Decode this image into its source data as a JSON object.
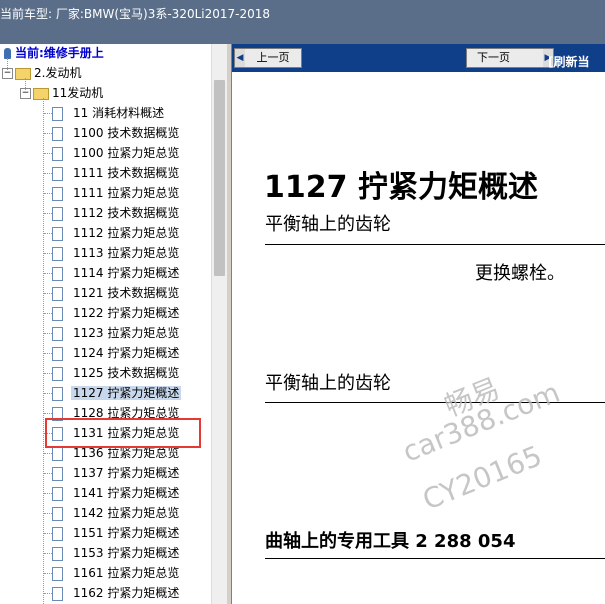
{
  "window": {
    "title": "当前车型:  厂家:BMW(宝马)3系-320Li2017-2018"
  },
  "tree": {
    "root_label": "当前:维修手册上",
    "level1_label": "2.发动机",
    "level2_label": "11发动机",
    "items": [
      {
        "label": "11 消耗材料概述"
      },
      {
        "label": "1100 技术数据概览"
      },
      {
        "label": "1100 拉紧力矩总览"
      },
      {
        "label": "1111 技术数据概览"
      },
      {
        "label": "1111 拉紧力矩总览"
      },
      {
        "label": "1112 技术数据概览"
      },
      {
        "label": "1112 拉紧力矩总览"
      },
      {
        "label": "1113 拉紧力矩总览"
      },
      {
        "label": "1114 拧紧力矩概述"
      },
      {
        "label": "1121 技术数据概览"
      },
      {
        "label": "1122 拧紧力矩概述"
      },
      {
        "label": "1123 拉紧力矩总览"
      },
      {
        "label": "1124 拧紧力矩概述"
      },
      {
        "label": "1125 技术数据概览"
      },
      {
        "label": "1127 拧紧力矩概述"
      },
      {
        "label": "1128 拉紧力矩总览"
      },
      {
        "label": "1131 拉紧力矩总览"
      },
      {
        "label": "1136 拉紧力矩总览"
      },
      {
        "label": "1137 拧紧力矩概述"
      },
      {
        "label": "1141 拧紧力矩概述"
      },
      {
        "label": "1142 拉紧力矩总览"
      },
      {
        "label": "1151 拧紧力矩概述"
      },
      {
        "label": "1153 拧紧力矩概述"
      },
      {
        "label": "1161 拉紧力矩总览"
      },
      {
        "label": "1162 拧紧力矩概述"
      }
    ],
    "selected_label": "1127 拧紧力矩概述"
  },
  "nav": {
    "prev_label": "上一页",
    "next_label": "下一页",
    "refresh_label": "[刷新当"
  },
  "document": {
    "title": "1127 拧紧力矩概述",
    "section1_heading": "平衡轴上的齿轮",
    "section1_note": "更换螺栓。",
    "section2_heading": "平衡轴上的齿轮",
    "section3_heading": "曲轴上的专用工具 2 288 054"
  },
  "watermark": {
    "line1": "畅易",
    "line2": "car388.com",
    "line3": "CY20165"
  },
  "colors": {
    "topbar": "#5a6e89",
    "navbar": "#0f3f88",
    "selection_box": "#e53935"
  }
}
